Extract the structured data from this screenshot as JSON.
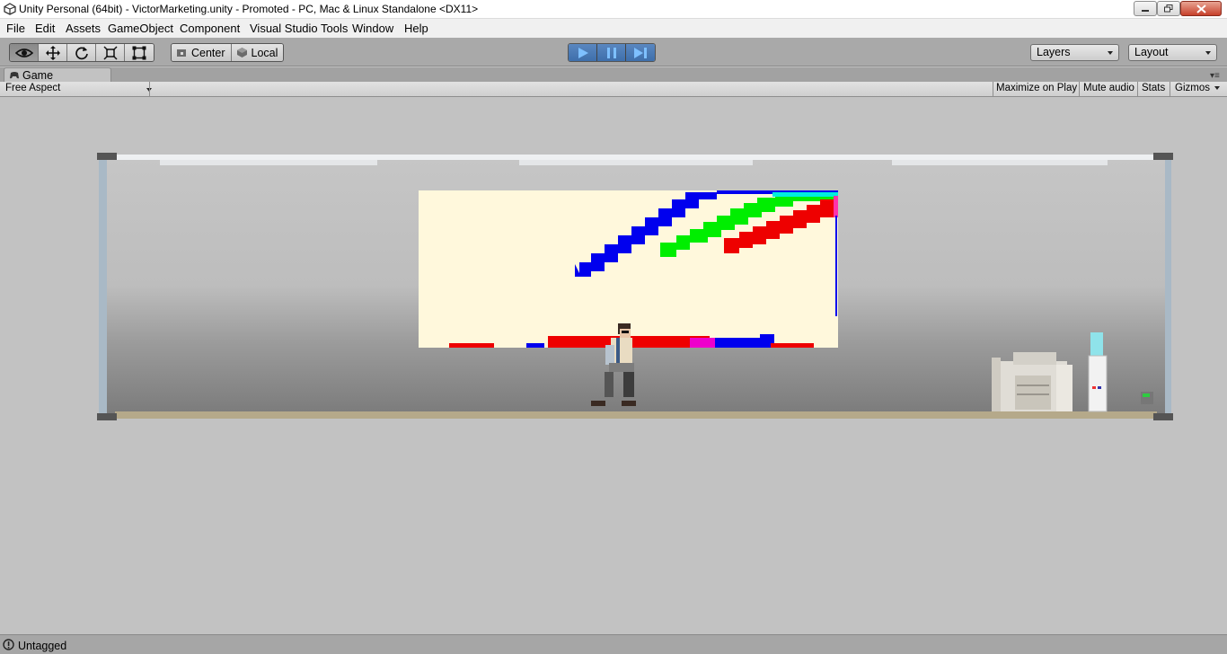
{
  "window": {
    "title": "Unity Personal (64bit) - VictorMarketing.unity - Promoted - PC, Mac & Linux Standalone <DX11>",
    "icon": "unity-logo-icon"
  },
  "menu": [
    "File",
    "Edit",
    "Assets",
    "GameObject",
    "Component",
    "Visual Studio Tools",
    "Window",
    "Help"
  ],
  "toolbar": {
    "tools": [
      "view-tool-icon",
      "move-tool-icon",
      "rotate-tool-icon",
      "scale-tool-icon",
      "rect-tool-icon"
    ],
    "pivot_mode": "Center",
    "pivot_rotation": "Local",
    "playback": {
      "play": "play-icon",
      "pause": "pause-icon",
      "step": "step-icon",
      "play_active": true
    },
    "layers_label": "Layers",
    "layout_label": "Layout"
  },
  "tab": {
    "label": "Game",
    "icon": "game-controller-icon"
  },
  "gamebar": {
    "aspect": "Free Aspect",
    "maximize": "Maximize on Play",
    "mute": "Mute audio",
    "stats": "Stats",
    "gizmos": "Gizmos"
  },
  "status": {
    "text": "Untagged",
    "icon": "info-icon"
  },
  "colors": {
    "play_active": "#3e6fab",
    "chart_blue": "#0000ee",
    "chart_green": "#00ee00",
    "chart_red": "#ee0000",
    "whiteboard": "#fff8dc",
    "floor": "#b5a98a"
  }
}
